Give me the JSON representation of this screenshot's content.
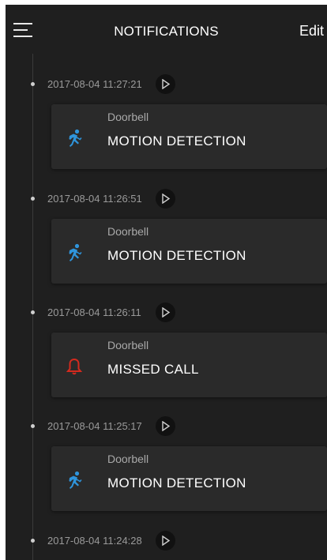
{
  "header": {
    "title": "NOTIFICATIONS",
    "edit_label": "Edit",
    "menu_icon": "hamburger-menu-icon"
  },
  "colors": {
    "background": "#1f1f1f",
    "card": "#2a2a2a",
    "motion_icon": "#2f95dc",
    "missed_call_icon": "#d42a1e",
    "timestamp_text": "#9a9a9a"
  },
  "entries": [
    {
      "timestamp": "2017-08-04 11:27:21",
      "device": "Doorbell",
      "event": "MOTION DETECTION",
      "icon": "running-person-icon"
    },
    {
      "timestamp": "2017-08-04 11:26:51",
      "device": "Doorbell",
      "event": "MOTION DETECTION",
      "icon": "running-person-icon"
    },
    {
      "timestamp": "2017-08-04 11:26:11",
      "device": "Doorbell",
      "event": "MISSED CALL",
      "icon": "bell-icon"
    },
    {
      "timestamp": "2017-08-04 11:25:17",
      "device": "Doorbell",
      "event": "MOTION DETECTION",
      "icon": "running-person-icon"
    },
    {
      "timestamp": "2017-08-04 11:24:28"
    }
  ]
}
